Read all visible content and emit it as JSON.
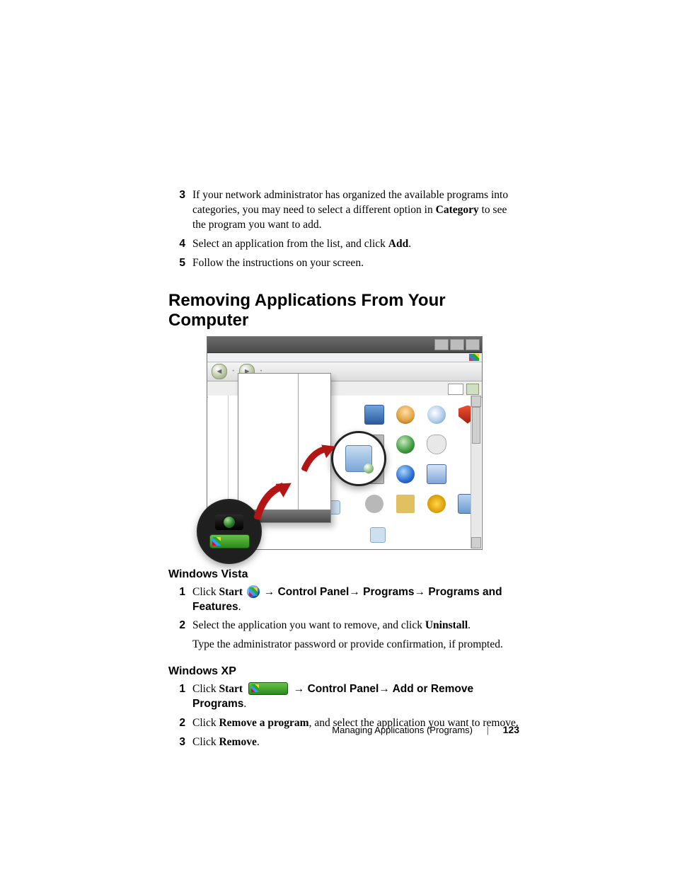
{
  "top_list": [
    {
      "n": "3",
      "before": "If your network administrator has organized the available programs into categories, you may need to select a different option in ",
      "bold": "Category",
      "after": " to see the program you want to add."
    },
    {
      "n": "4",
      "before": "Select an application from the list, and click ",
      "bold": "Add",
      "after": "."
    },
    {
      "n": "5",
      "before": "Follow the instructions on your screen.",
      "bold": "",
      "after": ""
    }
  ],
  "heading": "Removing Applications From Your Computer",
  "vista": {
    "title": "Windows Vista",
    "s1": {
      "click": "Click ",
      "start": "Start",
      "path": "→ Control Panel→ Programs→ Programs and Features",
      "after": "."
    },
    "s2": {
      "before": "Select the application you want to remove, and click ",
      "bold": "Uninstall",
      "after": "."
    },
    "s2b": "Type the administrator password or provide confirmation, if prompted."
  },
  "xp": {
    "title": "Windows XP",
    "s1": {
      "click": "Click ",
      "start": "Start",
      "path": "→ Control Panel→ Add or Remove Programs",
      "after": "."
    },
    "s2": {
      "before": "Click ",
      "bold": "Remove a program",
      "after": ", and select the application you want to remove."
    },
    "s3": {
      "before": "Click ",
      "bold": "Remove",
      "after": "."
    }
  },
  "footer": {
    "section": "Managing Applications (Programs)",
    "page": "123"
  }
}
